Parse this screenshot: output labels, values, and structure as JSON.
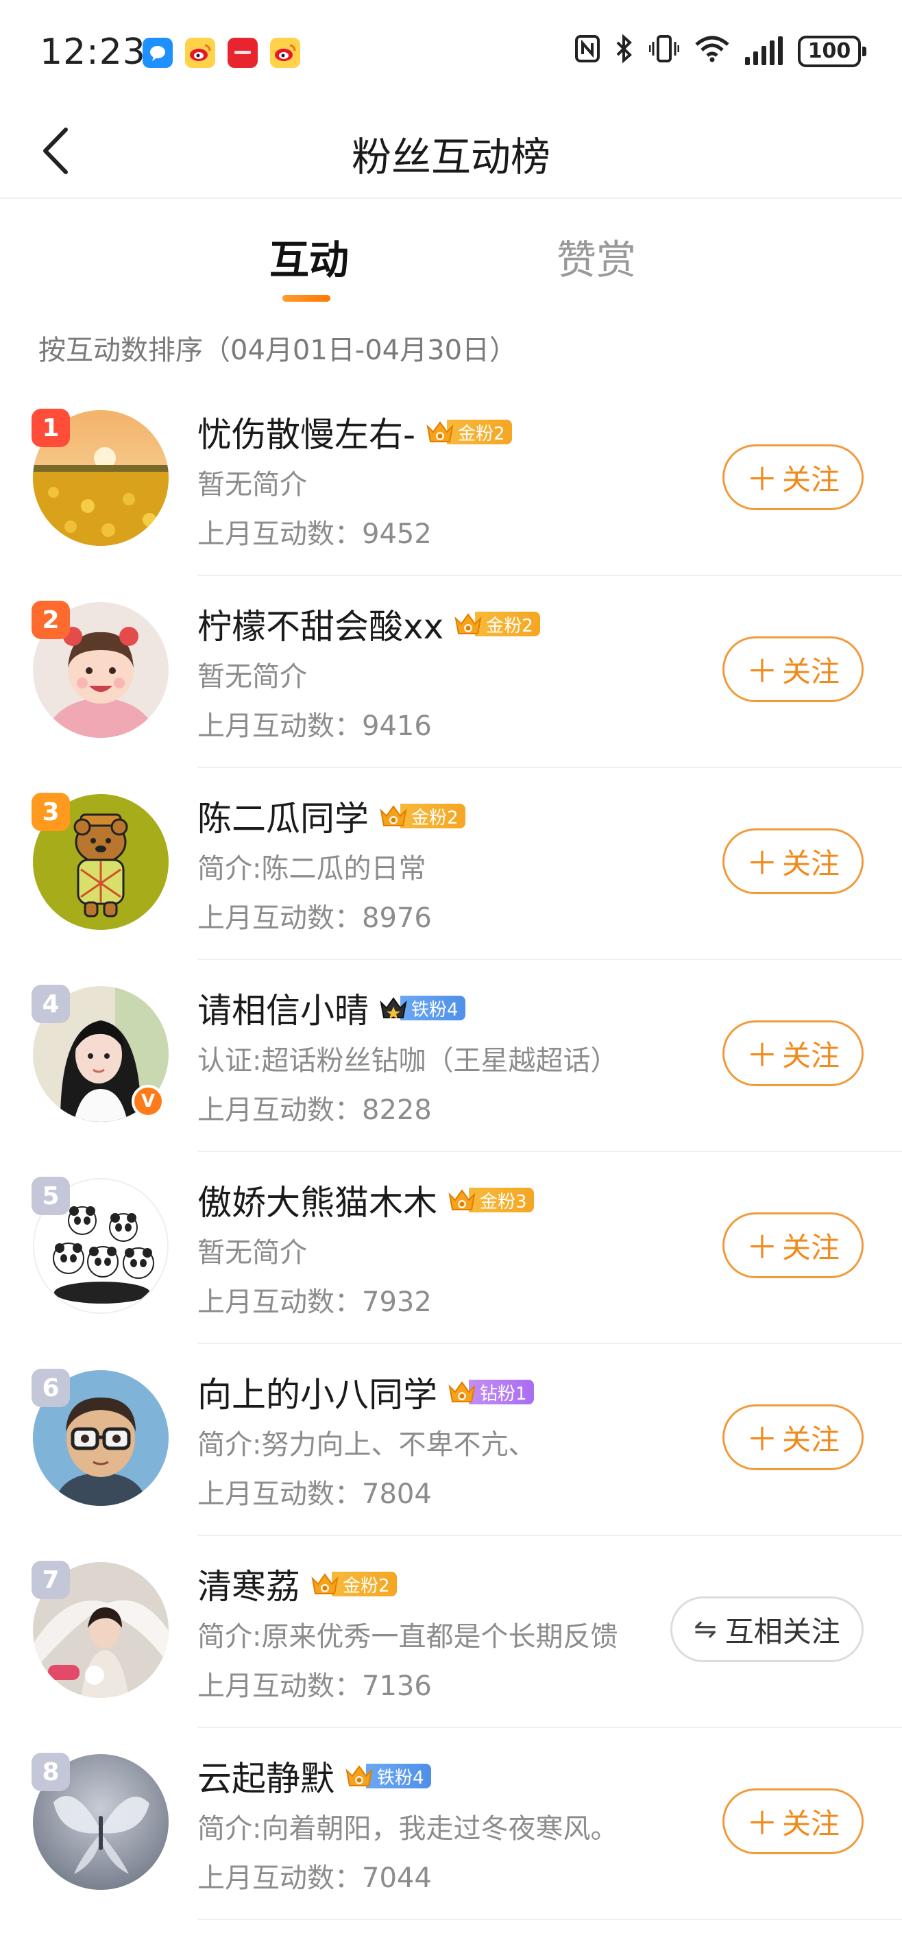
{
  "status_bar": {
    "time": "12:23",
    "battery": "100"
  },
  "header": {
    "title": "粉丝互动榜"
  },
  "tabs": [
    {
      "label": "互动",
      "active": true
    },
    {
      "label": "赞赏",
      "active": false
    }
  ],
  "sort_label": "按互动数排序（04月01日-04月30日）",
  "count_prefix": "上月互动数：",
  "follow_label": "关注",
  "mutual_label": "互相关注",
  "fans": [
    {
      "rank": "1",
      "name": "忧伤散慢左右-",
      "badge_type": "gold",
      "badge_label": "金粉2",
      "desc": "暂无简介",
      "count": "9452",
      "button": "follow"
    },
    {
      "rank": "2",
      "name": "柠檬不甜会酸xx",
      "badge_type": "gold",
      "badge_label": "金粉2",
      "desc": "暂无简介",
      "count": "9416",
      "button": "follow"
    },
    {
      "rank": "3",
      "name": "陈二瓜同学",
      "badge_type": "gold",
      "badge_label": "金粉2",
      "desc": "简介:陈二瓜的日常",
      "count": "8976",
      "button": "follow"
    },
    {
      "rank": "4",
      "name": "请相信小晴",
      "badge_type": "iron",
      "badge_label": "铁粉4",
      "desc": "认证:超话粉丝钻咖（王星越超话）",
      "count": "8228",
      "button": "follow"
    },
    {
      "rank": "5",
      "name": "傲娇大熊猫木木",
      "badge_type": "gold",
      "badge_label": "金粉3",
      "desc": "暂无简介",
      "count": "7932",
      "button": "follow"
    },
    {
      "rank": "6",
      "name": "向上的小八同学",
      "badge_type": "diamond",
      "badge_label": "钻粉1",
      "desc": "简介:努力向上、不卑不亢、",
      "count": "7804",
      "button": "follow"
    },
    {
      "rank": "7",
      "name": "清寒荔",
      "badge_type": "gold",
      "badge_label": "金粉2",
      "desc": "简介:原来优秀一直都是个长期反馈",
      "count": "7136",
      "button": "mutual"
    },
    {
      "rank": "8",
      "name": "云起静默",
      "badge_type": "iron",
      "badge_label": "铁粉4",
      "desc": "简介:向着朝阳，我走过冬夜寒风。",
      "count": "7044",
      "button": "follow"
    }
  ]
}
